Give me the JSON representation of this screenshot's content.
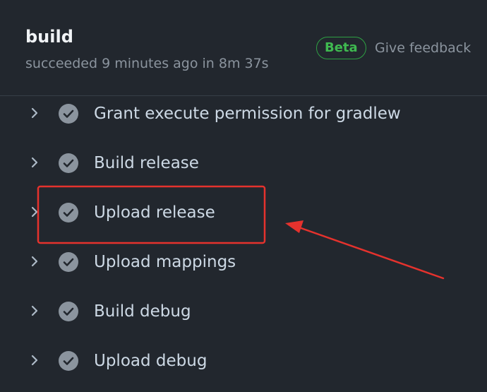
{
  "job": {
    "title": "build",
    "status_text": "succeeded 9 minutes ago in 8m 37s",
    "beta_label": "Beta",
    "feedback_label": "Give feedback"
  },
  "steps": [
    {
      "label": "Grant execute permission for gradlew",
      "status": "success"
    },
    {
      "label": "Build release",
      "status": "success"
    },
    {
      "label": "Upload release",
      "status": "success"
    },
    {
      "label": "Upload mappings",
      "status": "success"
    },
    {
      "label": "Build debug",
      "status": "success"
    },
    {
      "label": "Upload debug",
      "status": "success"
    }
  ],
  "icons": {
    "expand": "chevron-right-icon",
    "status": "check-circle-icon"
  },
  "colors": {
    "background": "#22272e",
    "beta_green": "#3fb950",
    "check_fill": "#8b949e",
    "annotation_red": "#e5322d"
  }
}
